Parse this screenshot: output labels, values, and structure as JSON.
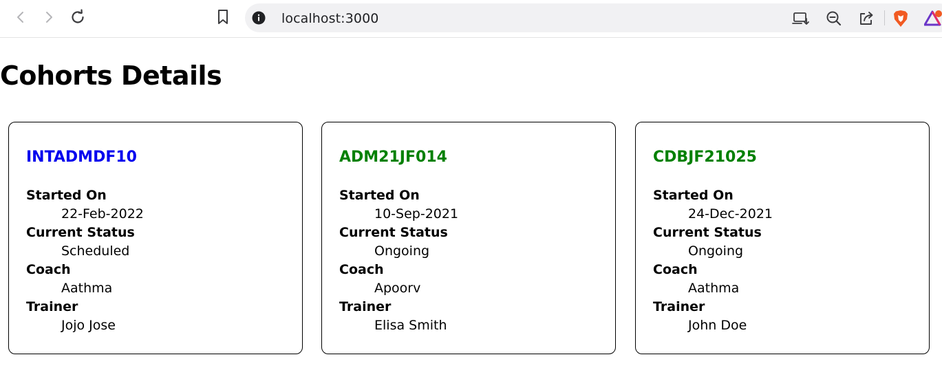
{
  "browser": {
    "url": "localhost:3000",
    "icons": {
      "back": "back-arrow-icon",
      "forward": "forward-arrow-icon",
      "reload": "reload-icon",
      "bookmark": "bookmark-icon",
      "site_info": "info-icon",
      "install": "install-app-icon",
      "zoom": "zoom-out-icon",
      "share": "share-icon",
      "brave": "brave-shield-icon",
      "rewards": "brave-rewards-icon"
    }
  },
  "page": {
    "title": "Cohorts Details"
  },
  "cohorts": [
    {
      "code": "INTADMDF10",
      "code_color": "#0000ee",
      "fields": [
        {
          "label": "Started On",
          "value": "22-Feb-2022"
        },
        {
          "label": "Current Status",
          "value": "Scheduled"
        },
        {
          "label": "Coach",
          "value": "Aathma"
        },
        {
          "label": "Trainer",
          "value": "Jojo Jose"
        }
      ]
    },
    {
      "code": "ADM21JF014",
      "code_color": "#008000",
      "fields": [
        {
          "label": "Started On",
          "value": "10-Sep-2021"
        },
        {
          "label": "Current Status",
          "value": "Ongoing"
        },
        {
          "label": "Coach",
          "value": "Apoorv"
        },
        {
          "label": "Trainer",
          "value": "Elisa Smith"
        }
      ]
    },
    {
      "code": "CDBJF21025",
      "code_color": "#008000",
      "fields": [
        {
          "label": "Started On",
          "value": "24-Dec-2021"
        },
        {
          "label": "Current Status",
          "value": "Ongoing"
        },
        {
          "label": "Coach",
          "value": "Aathma"
        },
        {
          "label": "Trainer",
          "value": "John Doe"
        }
      ]
    }
  ]
}
